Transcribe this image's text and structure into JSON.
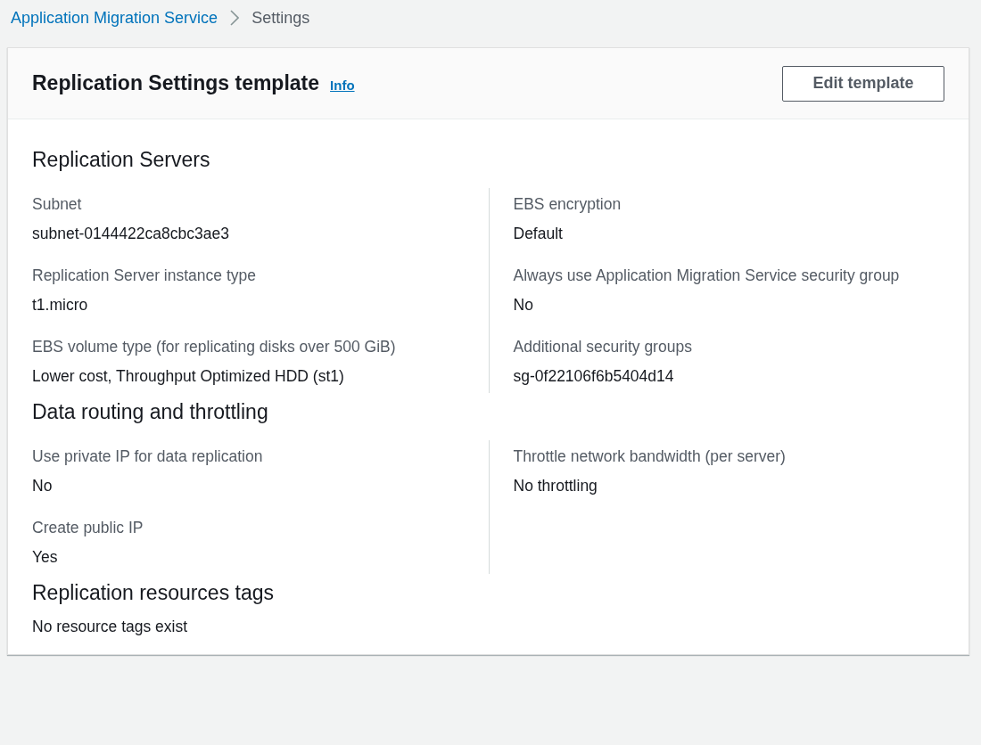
{
  "breadcrumb": [
    {
      "label": "Application Migration Service",
      "kind": "link"
    },
    {
      "label": "Settings",
      "kind": "current"
    }
  ],
  "header": {
    "title": "Replication Settings template",
    "info": "Info",
    "button": "Edit template"
  },
  "sections": [
    {
      "kind": "columns",
      "title": "Replication Servers",
      "columns": [
        [
          {
            "label": "Subnet",
            "value": "subnet-0144422ca8cbc3ae3"
          },
          {
            "label": "Replication Server instance type",
            "value": "t1.micro"
          },
          {
            "label": "EBS volume type (for replicating disks over 500 GiB)",
            "value": "Lower cost, Throughput Optimized HDD (st1)"
          }
        ],
        [
          {
            "label": "EBS encryption",
            "value": "Default"
          },
          {
            "label": "Always use Application Migration Service security group",
            "value": "No"
          },
          {
            "label": "Additional security groups",
            "value": "sg-0f22106f6b5404d14"
          }
        ]
      ]
    },
    {
      "kind": "columns",
      "title": "Data routing and throttling",
      "columns": [
        [
          {
            "label": "Use private IP for data replication",
            "value": "No"
          },
          {
            "label": "Create public IP",
            "value": "Yes"
          }
        ],
        [
          {
            "label": "Throttle network bandwidth (per server)",
            "value": "No throttling"
          }
        ]
      ]
    },
    {
      "kind": "text",
      "title": "Replication resources tags",
      "text": "No resource tags exist"
    }
  ]
}
